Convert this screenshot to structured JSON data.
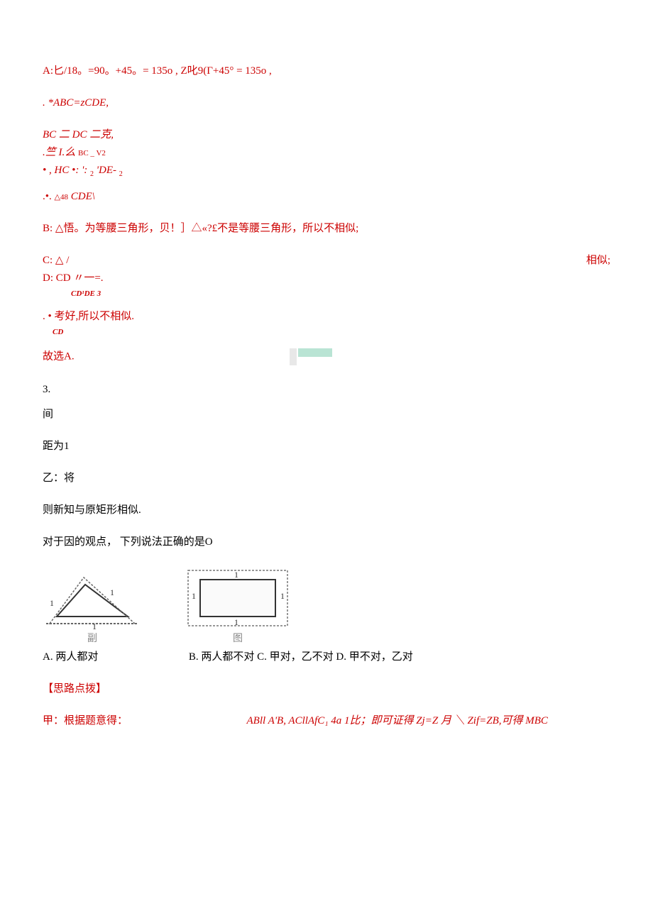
{
  "p1": "A:匕/18。=90。+45。= 135o ,  Z叱9(Γ+45°  = 135o ,",
  "p2": ". *ABC=zCDE,",
  "p3": "BC 二 DC 二克,",
  "p4a": ".竺 I.么 ",
  "p4b": "BC _ V2",
  "p5a": " • , HC •: ': ",
  "p5b": "2",
  "p5c": "'DE-",
  "p5d": "2",
  "p6a": ".•.",
  "p6b": "△48",
  "p6c": " CDE\\",
  "p7": "B: △悟。为等腰三角形，贝！］△«?£不是等腰三角形，所以不相似;",
  "p8a": "C:  △ /",
  "p8b": "相似;",
  "p9a": "D:   CD  〃一=.",
  "p9b": "CD¹DE 3",
  "p10a": ". • 考好,所以不相似.",
  "p10b": "CD",
  "p11": "故选A.",
  "q3": "3.",
  "q3a": "间",
  "q3b": "距为1",
  "q3c": "乙：将",
  "q3d": "则新知与原矩形相似.",
  "q3e": "对于因的观点，    下列说法正确的是O",
  "cap1": "副",
  "cap2": "图",
  "optA": "A. 两人都对",
  "optB": "B. 两人都不对",
  "optC": "C. 甲对，乙不对",
  "optD": "D. 甲不对，乙对",
  "hint": "【思路点拨】",
  "lastA": "甲：根据题意得：",
  "lastB": "ABll A'B,  ACllAfC₁ 4a 1比；即可证得 Zj=Z 月 ＼ Zif=ZB,可得 MBC"
}
